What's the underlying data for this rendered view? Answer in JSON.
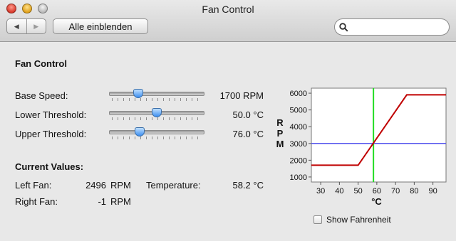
{
  "window": {
    "title": "Fan Control"
  },
  "toolbar": {
    "show_all_label": "Alle einblenden",
    "back_glyph": "◀",
    "forward_glyph": "▶",
    "search_placeholder": ""
  },
  "section": {
    "title": "Fan Control"
  },
  "settings": {
    "base_speed": {
      "label": "Base Speed:",
      "value": "1700 RPM",
      "slider_fraction": 0.28
    },
    "lower_threshold": {
      "label": "Lower Threshold:",
      "value": "50.0 °C",
      "slider_fraction": 0.5
    },
    "upper_threshold": {
      "label": "Upper Threshold:",
      "value": "76.0 °C",
      "slider_fraction": 0.3
    }
  },
  "current": {
    "title": "Current Values:",
    "left_fan_label": "Left Fan:",
    "left_fan_value": "2496",
    "left_fan_unit": "RPM",
    "right_fan_label": "Right Fan:",
    "right_fan_value": "-1",
    "right_fan_unit": "RPM",
    "temperature_label": "Temperature:",
    "temperature_value": "58.2 °C"
  },
  "checkbox": {
    "label": "Show Fahrenheit",
    "checked": false
  },
  "chart_data": {
    "type": "line",
    "ylabel": "RPM",
    "xlabel": "°C",
    "xlim": [
      25,
      97
    ],
    "ylim": [
      700,
      6300
    ],
    "xticks": [
      30,
      40,
      50,
      60,
      70,
      80,
      90
    ],
    "yticks": [
      1000,
      2000,
      3000,
      4000,
      5000,
      6000
    ],
    "fan_curve": {
      "x": [
        25,
        50,
        76,
        97
      ],
      "y": [
        1700,
        1700,
        5900,
        5900
      ],
      "color": "#c00000"
    },
    "current_rpm": {
      "y": 3000,
      "color": "#5555ee"
    },
    "current_temperature": {
      "x": 58.2,
      "color": "#22dd22"
    }
  }
}
